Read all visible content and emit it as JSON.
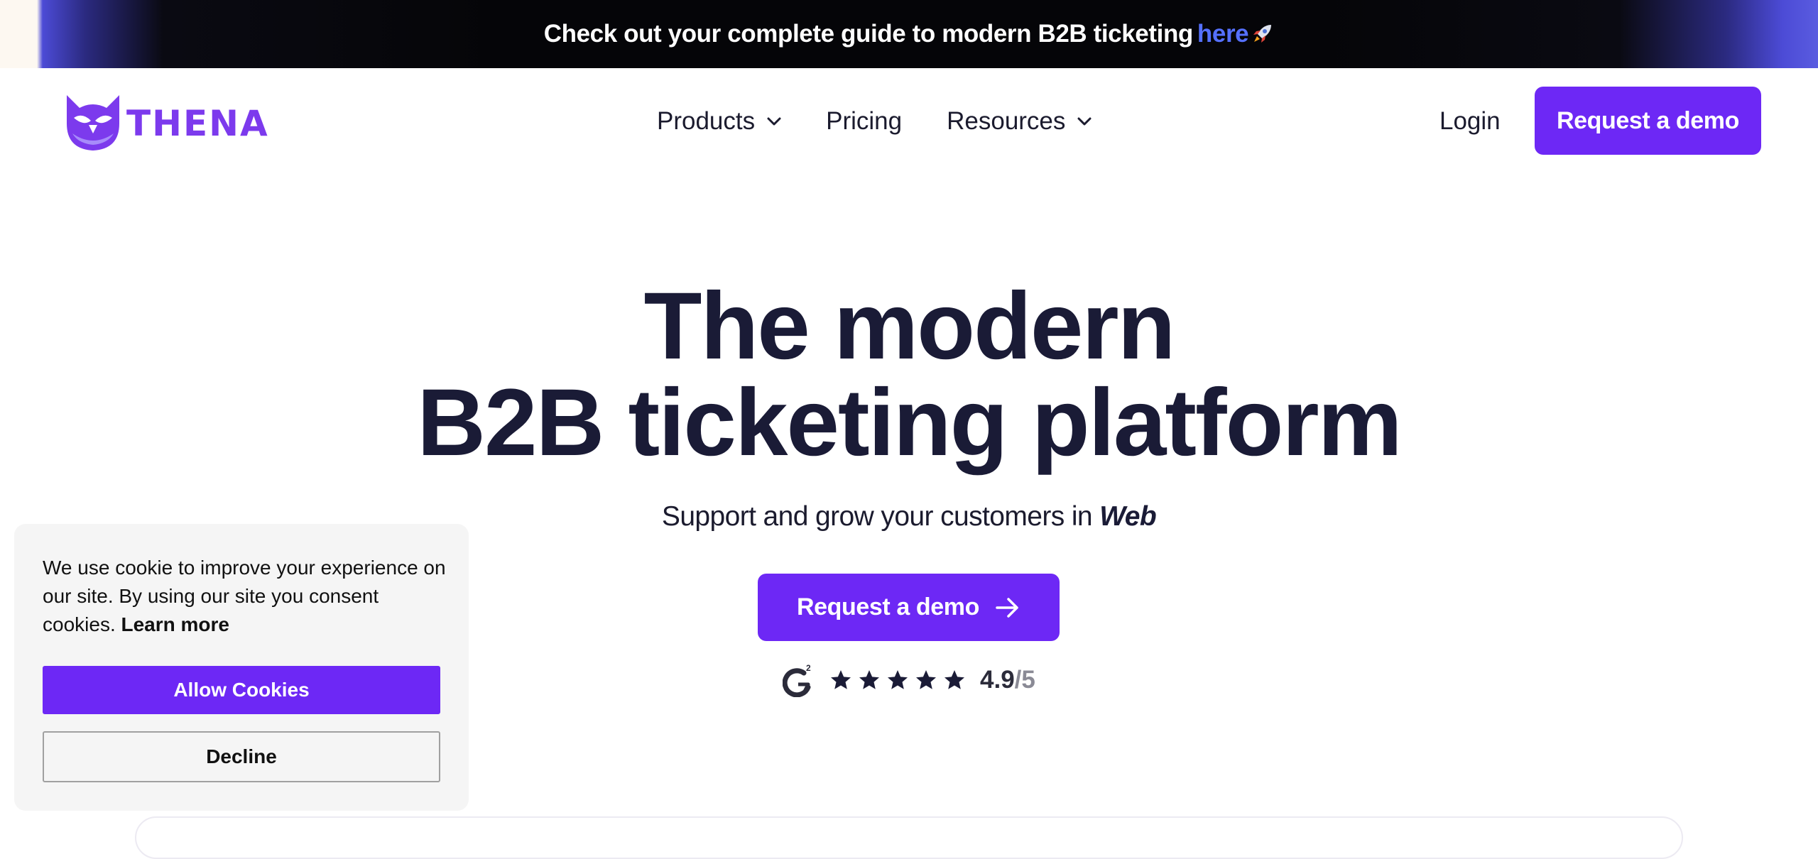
{
  "announcement": {
    "text": "Check out your complete guide to modern B2B ticketing",
    "link_text": "here",
    "icon": "rocket-icon"
  },
  "navbar": {
    "logo_text": "THENA",
    "logo_icon": "owl-logo-icon",
    "items": [
      {
        "label": "Products",
        "has_dropdown": true
      },
      {
        "label": "Pricing",
        "has_dropdown": false
      },
      {
        "label": "Resources",
        "has_dropdown": true
      }
    ],
    "login_label": "Login",
    "demo_label": "Request a demo"
  },
  "hero": {
    "title_line1": "The modern",
    "title_line2": "B2B ticketing platform",
    "subtitle_prefix": "Support and grow your customers in",
    "subtitle_word": "Web",
    "cta_label": "Request a demo",
    "cta_icon": "arrow-right-icon"
  },
  "rating": {
    "source_icon": "g2-icon",
    "stars": 5,
    "value": "4.9",
    "max": "/5"
  },
  "cookie_banner": {
    "text": "We use cookie to improve your experience on our site. By using our site you consent cookies.",
    "learn_more": "Learn more",
    "allow_label": "Allow Cookies",
    "decline_label": "Decline"
  },
  "colors": {
    "brand": "#6d28f5",
    "logo": "#7c3aed",
    "heading": "#1a1b36",
    "link": "#5570ff",
    "announce_bg": "#050508"
  }
}
